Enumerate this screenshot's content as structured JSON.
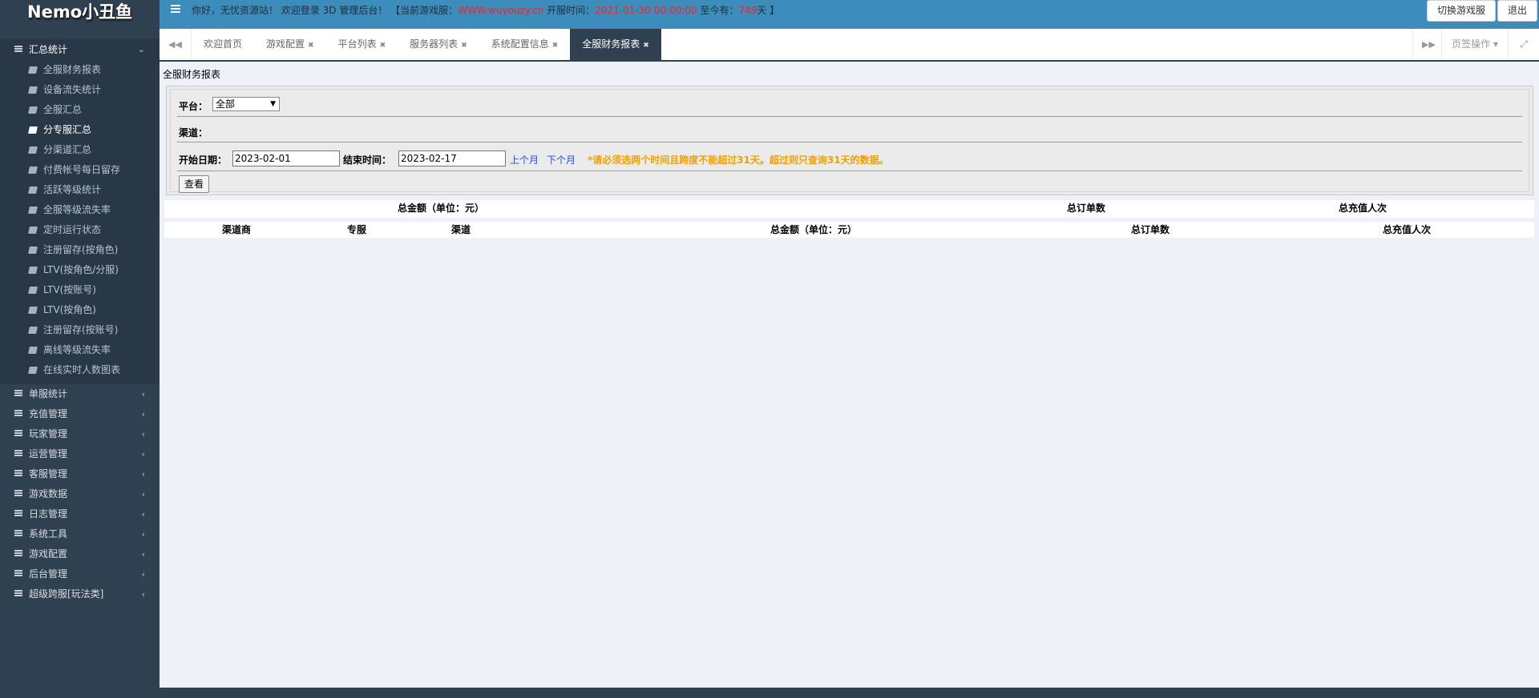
{
  "app": {
    "logo": "Nemo小丑鱼"
  },
  "sidebar": {
    "open_group": "汇总统计",
    "sub_items": [
      "全服财务报表",
      "设备流失统计",
      "全服汇总",
      "分专服汇总",
      "分渠道汇总",
      "付费帐号每日留存",
      "活跃等级统计",
      "全服等级流失率",
      "定时运行状态",
      "注册留存(按角色)",
      "LTV(按角色/分服)",
      "LTV(按账号)",
      "LTV(按角色)",
      "注册留存(按账号)",
      "离线等级流失率",
      "在线实时人数图表"
    ],
    "active_sub_index": 3,
    "groups": [
      "单服统计",
      "充值管理",
      "玩家管理",
      "运营管理",
      "客服管理",
      "游戏数据",
      "日志管理",
      "系统工具",
      "游戏配置",
      "后台管理",
      "超级跨服[玩法类]"
    ]
  },
  "topbar": {
    "greeting": "你好，无忧资源站！ 欢迎登录 3D 管理后台！ 【当前游戏服：",
    "server": "WWW.wuyouzy.cn",
    "open_time_label": " 开服时间：",
    "open_time": "2021-01-30 00:00:00",
    "until_label": " 至今有：",
    "days": "749",
    "days_suffix": "天 】",
    "switch_server_label": "切换游戏服",
    "logout_label": "退出"
  },
  "tabs": {
    "items": [
      {
        "label": "欢迎首页",
        "closable": false
      },
      {
        "label": "游戏配置",
        "closable": true
      },
      {
        "label": "平台列表",
        "closable": true
      },
      {
        "label": "服务器列表",
        "closable": true
      },
      {
        "label": "系统配置信息",
        "closable": true
      },
      {
        "label": "全服财务报表",
        "closable": true
      }
    ],
    "active_index": 5,
    "ops_label": "页签操作"
  },
  "page": {
    "title": "全服财务报表",
    "platform_label": "平台：",
    "platform_value": "全部",
    "channel_label": "渠道：",
    "start_label": "开始日期：",
    "start_value": "2023-02-01",
    "end_label": "结束时间：",
    "end_value": "2023-02-17",
    "prev_month": "上个月",
    "next_month": "下个月",
    "warning": "*请必须选两个时间且跨度不能超过31天。超过则只查询31天的数据。",
    "query_button": "查看"
  },
  "summary_headers": [
    "总金额（单位：元）",
    "总订单数",
    "总充值人次"
  ],
  "table_headers": [
    "渠道商",
    "专服",
    "渠道",
    "总金额（单位：元）",
    "总订单数",
    "总充值人次"
  ]
}
